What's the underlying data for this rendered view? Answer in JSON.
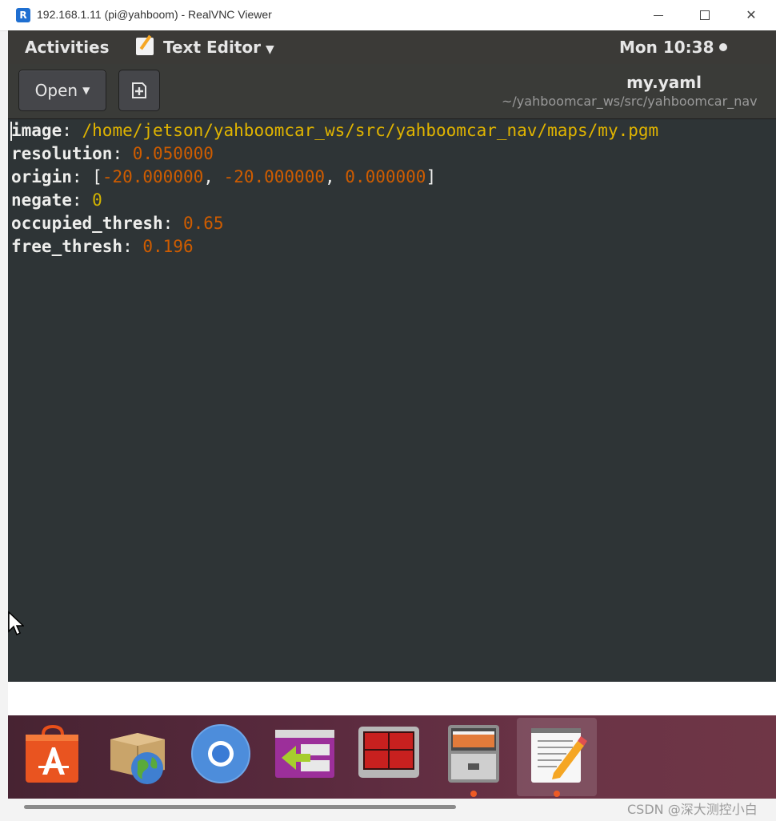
{
  "window": {
    "title": "192.168.1.11 (pi@yahboom) - RealVNC Viewer",
    "logo_letter": "R",
    "minimize_label": "",
    "maximize_label": "",
    "close_label": "✕"
  },
  "top_panel": {
    "activities": "Activities",
    "app_menu": "Text Editor",
    "app_menu_caret": "▼",
    "clock": "Mon 10:38"
  },
  "header": {
    "open_label": "Open",
    "open_caret": "▼",
    "title": "my.yaml",
    "path": "~/yahboomcar_ws/src/yahboomcar_nav"
  },
  "editor": {
    "lines": [
      {
        "key": "image",
        "sep": ": ",
        "value": "/home/jetson/yahboomcar_ws/src/yahboomcar_nav/maps/my.pgm"
      },
      {
        "key": "resolution",
        "sep": ": ",
        "value": "0.050000"
      },
      {
        "key": "origin",
        "sep": ": ",
        "open": "[",
        "v1": "-20.000000",
        "c1": ", ",
        "v2": "-20.000000",
        "c2": ", ",
        "v3": "0.000000",
        "close": "]"
      },
      {
        "key": "negate",
        "sep": ": ",
        "value": "0"
      },
      {
        "key": "occupied_thresh",
        "sep": ": ",
        "value": "0.65"
      },
      {
        "key": "free_thresh",
        "sep": ": ",
        "value": "0.196"
      }
    ]
  },
  "dock": {
    "items": [
      {
        "name": "ubuntu-software-icon",
        "running": false
      },
      {
        "name": "archive-manager-icon",
        "running": false
      },
      {
        "name": "chromium-icon",
        "running": false
      },
      {
        "name": "remmina-icon",
        "running": false
      },
      {
        "name": "terminator-icon",
        "running": false
      },
      {
        "name": "file-cabinet-icon",
        "running": true
      },
      {
        "name": "text-editor-icon",
        "running": true,
        "active": true
      }
    ]
  },
  "watermark": "CSDN @深大测控小白",
  "colors": {
    "editor_bg": "#2e3436",
    "string": "#e0b400",
    "number": "#ce5c00",
    "key": "#eeeeec",
    "dock_dot": "#ee5a24"
  }
}
